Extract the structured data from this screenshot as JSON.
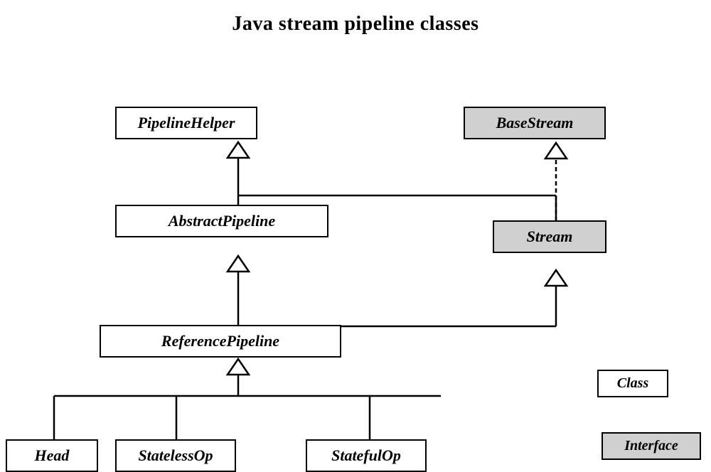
{
  "title": "Java stream pipeline classes",
  "boxes": {
    "pipelineHelper": {
      "label": "PipelineHelper",
      "type": "class"
    },
    "baseStream": {
      "label": "BaseStream",
      "type": "interface"
    },
    "abstractPipeline": {
      "label": "AbstractPipeline",
      "type": "class"
    },
    "stream": {
      "label": "Stream",
      "type": "interface"
    },
    "referencePipeline": {
      "label": "ReferencePipeline",
      "type": "class"
    },
    "head": {
      "label": "Head",
      "type": "class"
    },
    "statelessOp": {
      "label": "StatelessOp",
      "type": "class"
    },
    "statefulOp": {
      "label": "StatefulOp",
      "type": "class"
    }
  },
  "legend": {
    "class_label": "Class",
    "interface_label": "Interface"
  }
}
